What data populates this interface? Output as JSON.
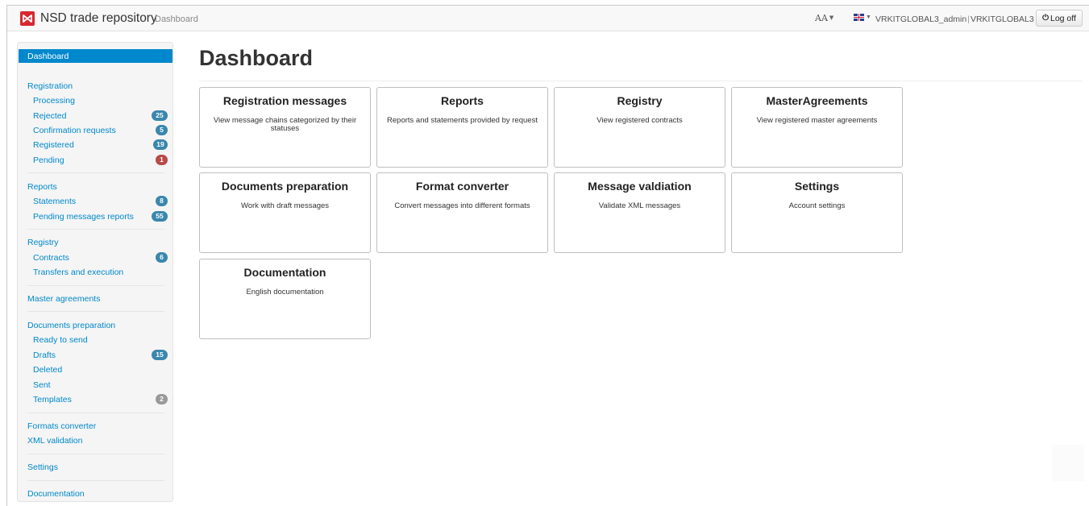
{
  "header": {
    "brand": "NSD trade repository",
    "breadcrumb": "Dashboard",
    "font_size_label": "AA",
    "user": "VRKITGLOBAL3_admin",
    "separator": "|",
    "org": "VRKITGLOBAL3",
    "logoff": "Log off"
  },
  "sidebar": {
    "active": "Dashboard",
    "registration": {
      "label": "Registration",
      "items": [
        {
          "label": "Processing",
          "badge": ""
        },
        {
          "label": "Rejected",
          "badge": "25"
        },
        {
          "label": "Confirmation requests",
          "badge": "5"
        },
        {
          "label": "Registered",
          "badge": "19"
        },
        {
          "label": "Pending",
          "badge": "1"
        }
      ]
    },
    "reports": {
      "label": "Reports",
      "items": [
        {
          "label": "Statements",
          "badge": "8"
        },
        {
          "label": "Pending messages reports",
          "badge": "55"
        }
      ]
    },
    "registry": {
      "label": "Registry",
      "items": [
        {
          "label": "Contracts",
          "badge": "6"
        },
        {
          "label": "Transfers and execution",
          "badge": ""
        }
      ]
    },
    "master_agreements": "Master agreements",
    "documents": {
      "label": "Documents preparation",
      "items": [
        {
          "label": "Ready to send",
          "badge": ""
        },
        {
          "label": "Drafts",
          "badge": "15"
        },
        {
          "label": "Deleted",
          "badge": ""
        },
        {
          "label": "Sent",
          "badge": ""
        },
        {
          "label": "Templates",
          "badge": "2"
        }
      ]
    },
    "formats_converter": "Formats converter",
    "xml_validation": "XML validation",
    "settings": "Settings",
    "documentation": "Documentation"
  },
  "main": {
    "title": "Dashboard",
    "cards": [
      {
        "title": "Registration messages",
        "desc": "View message chains categorized by their statuses"
      },
      {
        "title": "Reports",
        "desc": "Reports and statements provided by request"
      },
      {
        "title": "Registry",
        "desc": "View registered contracts"
      },
      {
        "title": "MasterAgreements",
        "desc": "View registered master agreements"
      },
      {
        "title": "Documents preparation",
        "desc": "Work with draft messages"
      },
      {
        "title": "Format converter",
        "desc": "Convert messages into different formats"
      },
      {
        "title": "Message valdiation",
        "desc": "Validate XML messages"
      },
      {
        "title": "Settings",
        "desc": "Account settings"
      },
      {
        "title": "Documentation",
        "desc": "English documentation"
      }
    ]
  },
  "colors": {
    "accent": "#0088cc",
    "badge_blue": "#3a87ad",
    "badge_red": "#b94a48",
    "badge_gray": "#999999",
    "logo_red": "#d7282f"
  }
}
